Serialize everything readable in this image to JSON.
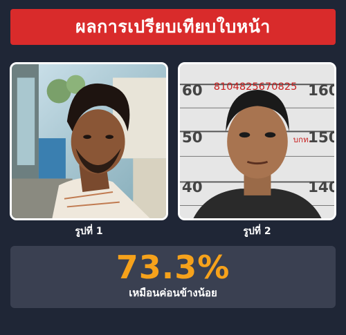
{
  "header": {
    "title": "ผลการเปรียบเทียบใบหน้า"
  },
  "photos": [
    {
      "caption": "รูปที่ 1"
    },
    {
      "caption": "รูปที่ 2",
      "mugshot_text": {
        "id_number": "8104825670825",
        "height_marks": [
          "60",
          "50",
          "40",
          "160",
          "150",
          "140"
        ],
        "stamp": "บกท."
      }
    }
  ],
  "result": {
    "similarity": "73.3%",
    "label": "เหมือนค่อนข้างน้อย"
  },
  "colors": {
    "background": "#1f2636",
    "header": "#d92b2b",
    "result_box": "#3a4051",
    "percent": "#f6a21b"
  }
}
